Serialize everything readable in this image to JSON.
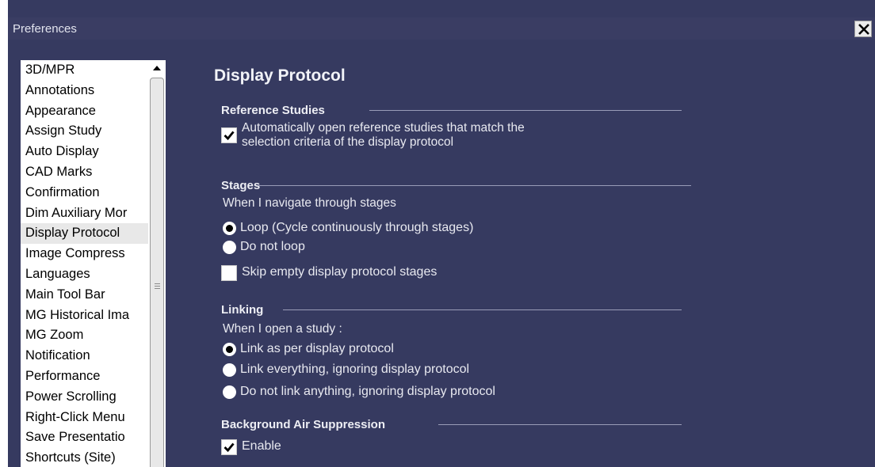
{
  "window": {
    "title": "Preferences",
    "close_label": "close"
  },
  "sidebar": {
    "selected": "Display Protocol",
    "items": [
      {
        "label": "3D/MPR"
      },
      {
        "label": "Annotations"
      },
      {
        "label": "Appearance"
      },
      {
        "label": "Assign Study"
      },
      {
        "label": "Auto Display"
      },
      {
        "label": "CAD Marks"
      },
      {
        "label": "Confirmation"
      },
      {
        "label": "Dim Auxiliary Mor"
      },
      {
        "label": "Display Protocol"
      },
      {
        "label": "Image Compress"
      },
      {
        "label": "Languages"
      },
      {
        "label": "Main Tool Bar"
      },
      {
        "label": "MG Historical Ima"
      },
      {
        "label": "MG Zoom"
      },
      {
        "label": "Notification"
      },
      {
        "label": "Performance"
      },
      {
        "label": "Power Scrolling"
      },
      {
        "label": "Right-Click Menu"
      },
      {
        "label": "Save Presentatio"
      },
      {
        "label": "Shortcuts (Site)"
      }
    ]
  },
  "page": {
    "title": "Display Protocol",
    "reference_studies": {
      "heading": "Reference Studies",
      "auto_open_line1": "Automatically open reference studies  that match the",
      "auto_open_line2": "selection criteria of the display protocol",
      "auto_open_checked": true
    },
    "stages": {
      "heading": "Stages",
      "prompt": "When I navigate through stages",
      "options": [
        {
          "label": "Loop (Cycle continuously through stages)",
          "selected": true
        },
        {
          "label": "Do not loop",
          "selected": false
        }
      ],
      "skip_empty_label": "Skip empty display protocol stages",
      "skip_empty_checked": false
    },
    "linking": {
      "heading": "Linking",
      "prompt": "When I open a study :",
      "options": [
        {
          "label": "Link as per display protocol",
          "selected": true
        },
        {
          "label": "Link everything, ignoring display protocol",
          "selected": false
        },
        {
          "label": "Do not link anything, ignoring display protocol",
          "selected": false
        }
      ]
    },
    "background_air": {
      "heading": "Background Air Suppression",
      "enable_label": "Enable",
      "enable_checked": true
    }
  }
}
